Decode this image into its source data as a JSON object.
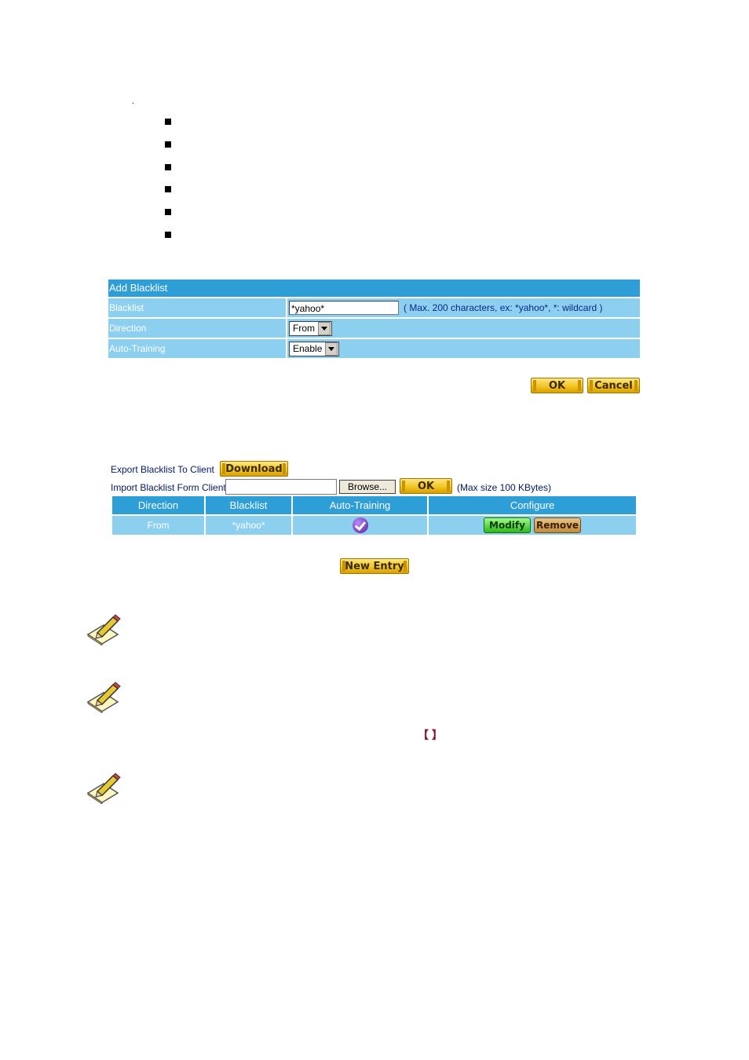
{
  "add_blacklist": {
    "title": "Add Blacklist",
    "blacklist_label": "Blacklist",
    "blacklist_value": "*yahoo*",
    "blacklist_hint": "( Max. 200 characters, ex: *yahoo*, *: wildcard )",
    "direction_label": "Direction",
    "direction_value": "From",
    "auto_training_label": "Auto-Training",
    "auto_training_value": "Enable",
    "ok_label": "OK",
    "cancel_label": "Cancel"
  },
  "export": {
    "label": "Export Blacklist To Client",
    "button": "Download"
  },
  "import": {
    "label": "Import Blacklist Form Client",
    "browse_label": "Browse...",
    "ok_label": "OK",
    "hint": "(Max size 100 KBytes)"
  },
  "table": {
    "headers": [
      "Direction",
      "Blacklist",
      "Auto-Training",
      "Configure"
    ],
    "rows": [
      {
        "direction": "From",
        "blacklist": "*yahoo*",
        "auto_training_icon": "check-icon",
        "modify": "Modify",
        "remove": "Remove"
      }
    ]
  },
  "new_entry_label": "New Entry",
  "dot": ".",
  "brackets": "【 】"
}
